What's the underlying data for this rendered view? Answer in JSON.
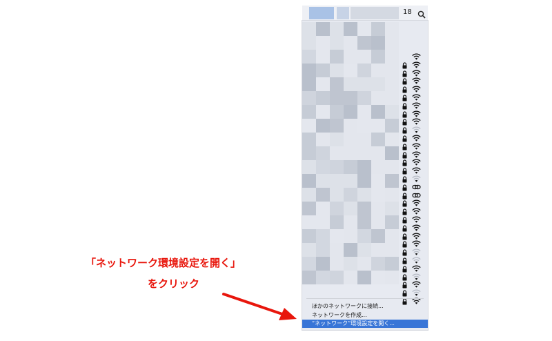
{
  "menubar": {
    "clock_partial": "18",
    "search_icon": "magnifier-icon"
  },
  "networks": {
    "count": 31,
    "lock_icon": "lock-icon",
    "signal_icon": "wifi-signal-icon",
    "name_text": "blurred"
  },
  "menu": {
    "items": [
      {
        "label": "ほかのネットワークに接続..."
      },
      {
        "label": "ネットワークを作成..."
      },
      {
        "label": "“ネットワーク”環境設定を開く..."
      }
    ],
    "highlight_color": "#3875d7"
  },
  "annotation": {
    "line1": "「ネットワーク環境設定を開く」",
    "line2": "をクリック",
    "color": "#e8160c"
  }
}
